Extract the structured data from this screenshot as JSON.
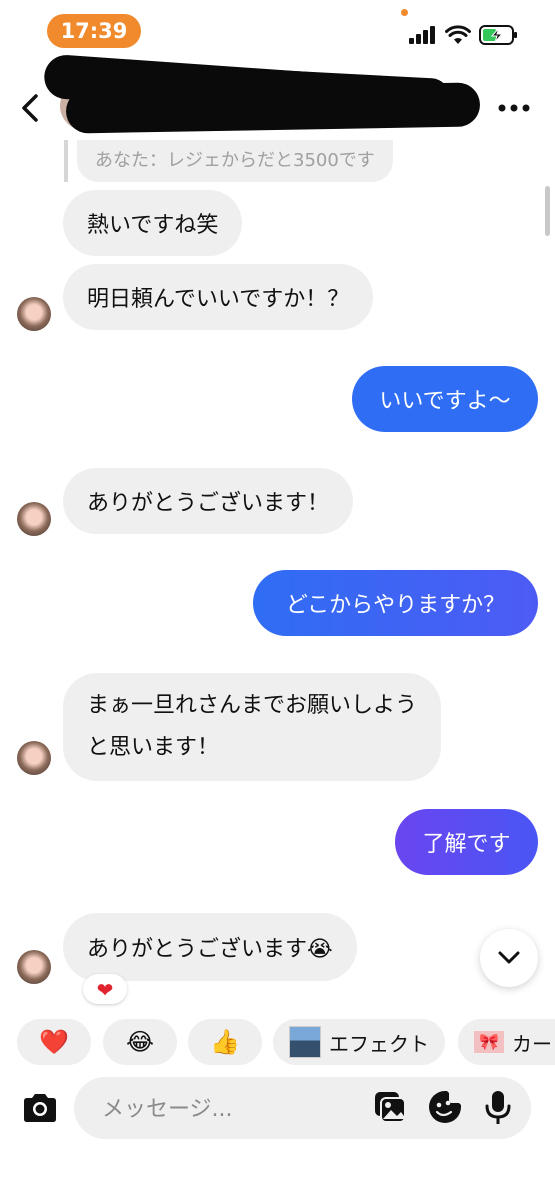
{
  "status_bar": {
    "time": "17:39"
  },
  "header": {
    "back_icon": "chevron-left-icon",
    "more_icon": "more-horizontal-icon"
  },
  "messages": [
    {
      "direction": "reply_quote",
      "text": "あなた：レジェからだと3500です"
    },
    {
      "direction": "in",
      "text": "熱いですね笑"
    },
    {
      "direction": "in",
      "text": "明日頼んでいいですか！？"
    },
    {
      "direction": "out",
      "text": "いいですよ〜"
    },
    {
      "direction": "in",
      "text": "ありがとうございます！"
    },
    {
      "direction": "out",
      "text": "どこからやりますか？"
    },
    {
      "direction": "in",
      "text": "まぁ一旦れさんまでお願いしようと思います！"
    },
    {
      "direction": "out",
      "text": "了解です"
    },
    {
      "direction": "in",
      "text": "ありがとうございます😭",
      "reaction": "❤"
    }
  ],
  "quick_reactions": [
    {
      "emoji": "❤️",
      "label": ""
    },
    {
      "emoji": "😂",
      "label": ""
    },
    {
      "emoji": "👍",
      "label": ""
    },
    {
      "emoji": "",
      "label": "エフェクト"
    },
    {
      "emoji": "",
      "label": "カー"
    }
  ],
  "composer": {
    "placeholder": "メッセージ..."
  },
  "colors": {
    "status_pill": "#f08a2c",
    "outgoing_bubble": "#2f6df4",
    "incoming_bubble": "#efefef"
  }
}
